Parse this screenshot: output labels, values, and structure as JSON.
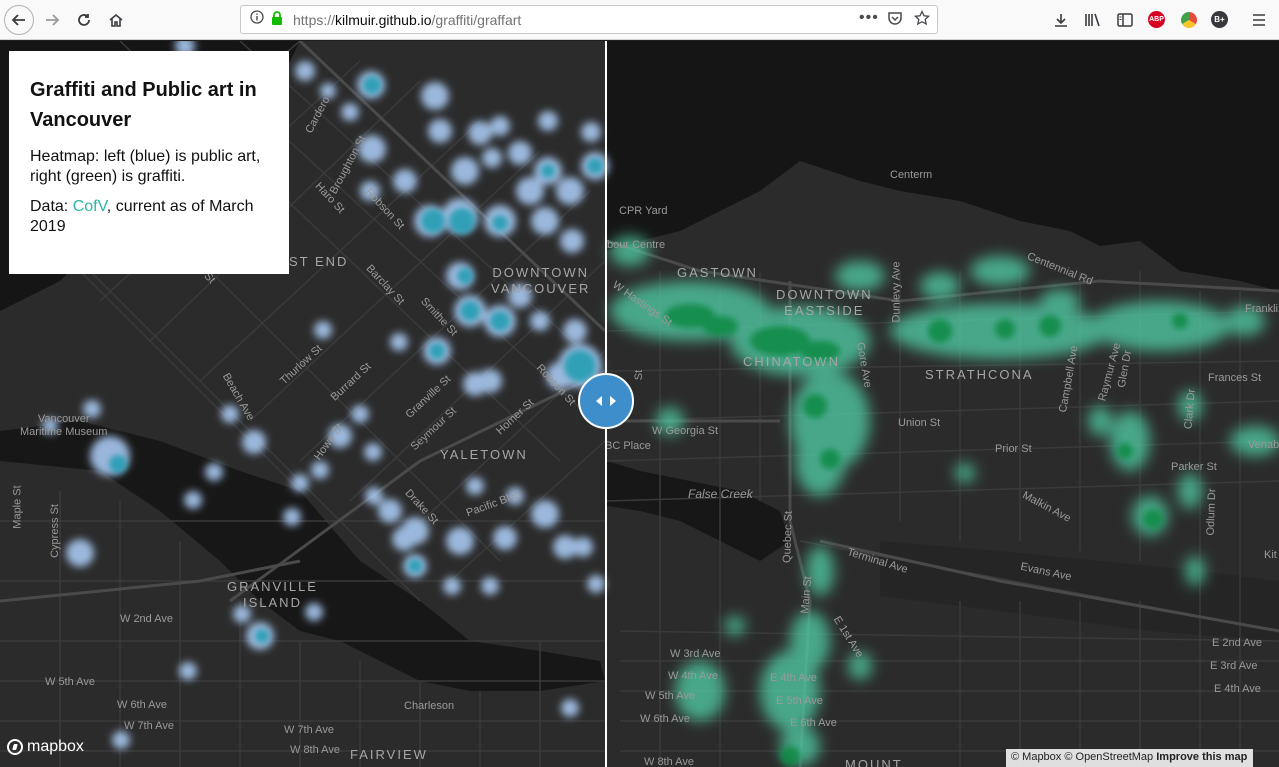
{
  "browser": {
    "url_prefix": "https://",
    "url_host": "kilmuir.github.io",
    "url_path": "/graffiti/graffart",
    "icons": [
      "back-icon",
      "forward-icon",
      "reload-icon",
      "home-icon",
      "info-icon",
      "lock-icon",
      "more-icon",
      "pocket-icon",
      "star-icon",
      "download-icon",
      "library-icon",
      "sidebar-icon",
      "adblock-icon",
      "chrome-extension-icon",
      "b-plus-icon",
      "menu-icon"
    ],
    "abp_label": "ABP",
    "bplus_label": "B+"
  },
  "panel": {
    "title": "Graffiti and Public art in Vancouver",
    "heatmap_text": "Heatmap: left (blue) is public art, right (green) is graffiti.",
    "data_prefix": "Data: ",
    "data_link": "CofV",
    "data_suffix": ", current as of March 2019",
    "link_color": "#2bb7a3"
  },
  "map": {
    "left_heat_color": "#2a9fb5",
    "right_heat_color": "#0d8a45",
    "street_labels": {
      "cardero": "Cardero",
      "broughton": "Broughton St",
      "haro": "Haro St",
      "robson": "Robson St",
      "west_end": "ST END",
      "barclay": "Barclay St",
      "smithe": "Smithe St",
      "thurlow": "Thurlow St",
      "burrard": "Burrard St",
      "granville": "Granville St",
      "seymour": "Seymour St",
      "homer": "Homer St",
      "robson2": "Robson St",
      "beach": "Beach Ave",
      "howe": "Howe St",
      "drake": "Drake St",
      "pacific": "Pacific Blvd",
      "maple": "Maple St",
      "cypress": "Cypress St",
      "w5": "W 5th Ave",
      "w6": "W 6th Ave",
      "w7": "W 7th Ave",
      "w7b": "W 7th Ave",
      "w8": "W 8th Ave",
      "w2": "W 2nd Ave",
      "charleson": "Charleson",
      "yy": "y St",
      "cprYard": "CPR Yard",
      "centerm": "Centerm",
      "harbour": "bour Centre",
      "whastings": "W Hastings St",
      "dunlevy": "Dunlevy Ave",
      "centennial": "Centennial Rd",
      "frankli": "Frankli",
      "gore": "Gore Ave",
      "campbell": "Campbell Ave",
      "raymur": "Raymur Ave",
      "glen": "Glen Dr",
      "frances": "Frances St",
      "clark": "Clark Dr",
      "venab": "Venab",
      "union": "Union St",
      "prior": "Prior St",
      "parker": "Parker St",
      "wgeorgia": "W Georgia St",
      "bcplace": "BC Place",
      "st": "St",
      "falsecreek": "False Creek",
      "malkin": "Malkin Ave",
      "odlum": "Odlum Dr",
      "quebec": "Quebec St",
      "terminal": "Terminal Ave",
      "evans": "Evans Ave",
      "main": "Main St",
      "e1st": "E 1st Ave",
      "e2nd": "E 2nd Ave",
      "e3rd": "E 3rd Ave",
      "e4th": "E 4th Ave",
      "e4th_b": "E 4th Ave",
      "e5th": "E 5th Ave",
      "e6th": "E 6th Ave",
      "w3rd": "W 3rd Ave",
      "w4th": "W 4th Ave",
      "w5th_r": "W 5th Ave",
      "w6th_r": "W 6th Ave",
      "w8th_r": "W 8th Ave",
      "kit": "Kit",
      "vanmar": "Vancouver\nMaritime Museum"
    },
    "neighbourhoods": {
      "downtown_vancouver": "DOWNTOWN\nVANCOUVER",
      "yaletown": "YALETOWN",
      "granville_island": "GRANVILLE\nISLAND",
      "fairview": "FAIRVIEW",
      "gastown": "GASTOWN",
      "downtown_eastside": "DOWNTOWN\nEASTSIDE",
      "chinatown": "CHINATOWN",
      "strathcona": "STRATHCONA",
      "mount": "MOUNT"
    }
  },
  "footer": {
    "mapbox": "mapbox",
    "attribution": "© Mapbox © OpenStreetMap",
    "improve": "Improve this map"
  }
}
